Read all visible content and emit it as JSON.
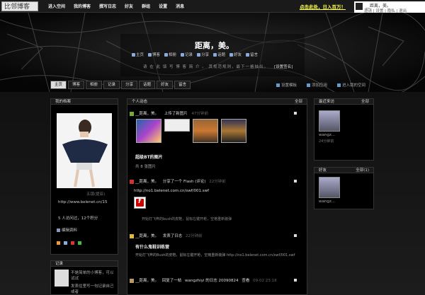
{
  "site": {
    "logo": "比邻博客",
    "promo": "点击此处，日入百万！"
  },
  "topnav": [
    "进入空间",
    "我的博客",
    "撰写日志",
    "好友",
    "群组",
    "设置",
    "消息"
  ],
  "user": {
    "name": "__距离，美。",
    "links": "邀请 | 设置 | 隐私 | 退出"
  },
  "blog": {
    "title": "距离，美。",
    "nav": [
      "主页",
      "博客",
      "相册",
      "记录",
      "分享",
      "话题",
      "好友",
      "留言"
    ],
    "desc": "请 在 此 填 写 博 客 简 介 。 其规范规则，最下一格抽出。",
    "set_sig": "[设置签名]"
  },
  "tabs": [
    "主页",
    "博客",
    "相册",
    "记录",
    "分享",
    "话题",
    "好友",
    "留言"
  ],
  "tools": [
    "设置模板",
    "添加应用",
    "进入我的空间"
  ],
  "profile": {
    "header": "我的档案",
    "photo_caption": "五镜(提亚)",
    "url": "http://www.belenet.cn/15",
    "stats": "5 人访问过，12个积分",
    "edit": "编辑资料"
  },
  "record": {
    "header": "记录",
    "text1": "不是简单的小博客，可以试试",
    "text2": "发表往里写一句记录自己或者"
  },
  "feed": {
    "header": "个人动态",
    "all": "全部",
    "items": [
      {
        "user": "__距离，美。",
        "action": "上传了新图片",
        "time": "47分钟前",
        "title": "超级BT的图片",
        "sub": "共 8 张图片"
      },
      {
        "user": "__距离，美。",
        "action": "分享了一个 Flash (评论)",
        "time": "22分钟前",
        "url": "http://no1.belenet.com.cn/swf/001.swf",
        "desc": "开始打飞奔的bush的皮鞋，鼠标左键开枪，空格重新装弹"
      },
      {
        "user": "__距离，美。",
        "action": "发表了日志",
        "time": "22分钟前",
        "title": "有什么鬼鞋训练营",
        "desc": "开始打飞奔的Bush的皮鞋，鼠标左键开枪，空格重新装弹 http://no1.belenet.com.cn/swf/001.swf"
      },
      {
        "user": "__距离，美。",
        "action": "回复了一帖",
        "extra": "wangzhiyi 的日志 20090824",
        "reply": "查看",
        "time": "09-02 23:18"
      }
    ]
  },
  "visitors": {
    "header": "最近来访",
    "all": "全部",
    "name": "wangz...",
    "time": "24分钟前"
  },
  "friends": {
    "header": "好友",
    "all": "全部(1)",
    "name": "wangz..."
  }
}
